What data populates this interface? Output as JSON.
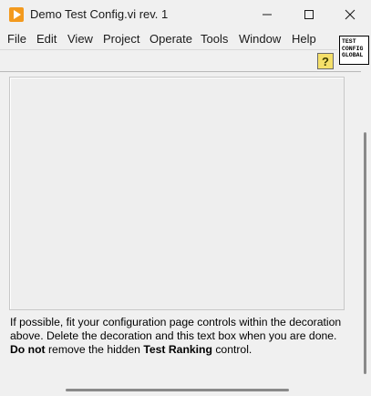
{
  "window": {
    "title": "Demo Test Config.vi rev. 1",
    "icon": "labview-run-icon",
    "controls": [
      "minimize-icon",
      "maximize-icon",
      "close-icon"
    ]
  },
  "menu": {
    "items": [
      "File",
      "Edit",
      "View",
      "Project",
      "Operate",
      "Tools",
      "Window",
      "Help"
    ]
  },
  "vi_icon": {
    "lines": [
      "TEST",
      "CONFIG",
      "GLOBAL"
    ]
  },
  "toolbar": {
    "help_label": "?"
  },
  "note": {
    "line1": "If possible, fit your configuration page controls within the decoration above.  Delete the decoration and this text box when you are done.",
    "bold1": "Do not",
    "mid": " remove the hidden ",
    "bold2": "Test Ranking",
    "end": " control."
  },
  "colors": {
    "background": "#f0f0f0",
    "help_button": "#f5e06a",
    "app_icon": "#f39a1e"
  }
}
